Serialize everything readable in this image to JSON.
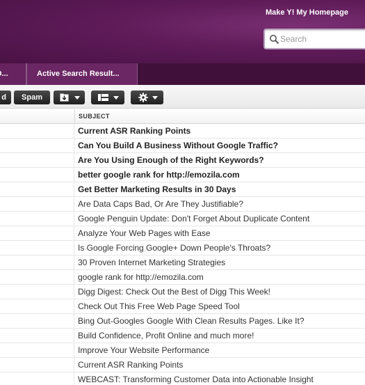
{
  "header": {
    "homepage_link": "Make Y! My Homepage",
    "search_placeholder": "Search"
  },
  "tabs": [
    {
      "label": "O..."
    },
    {
      "label": "Active Search Result..."
    }
  ],
  "toolbar": {
    "left_label": "d",
    "spam_label": "Spam"
  },
  "columns": {
    "subject": "SUBJECT"
  },
  "messages": [
    {
      "subject": "Current ASR Ranking Points",
      "unread": true
    },
    {
      "subject": "Can You Build A Business Without Google Traffic?",
      "unread": true
    },
    {
      "subject": "Are You Using Enough of the Right Keywords?",
      "unread": true
    },
    {
      "subject": "better google rank for http://emozila.com",
      "unread": true
    },
    {
      "subject": "Get Better Marketing Results in 30 Days",
      "unread": true
    },
    {
      "subject": "Are Data Caps Bad, Or Are They Justifiable?",
      "unread": false
    },
    {
      "subject": "Google Penguin Update: Don't Forget About Duplicate Content",
      "unread": false
    },
    {
      "subject": "Analyze Your Web Pages with Ease",
      "unread": false
    },
    {
      "subject": "Is Google Forcing Google+ Down People's Throats?",
      "unread": false
    },
    {
      "subject": "30 Proven Internet Marketing Strategies",
      "unread": false
    },
    {
      "subject": "google rank for http://emozila.com",
      "unread": false
    },
    {
      "subject": "Digg Digest: Check Out the Best of Digg This Week!",
      "unread": false
    },
    {
      "subject": "Check Out This Free Web Page Speed Tool",
      "unread": false
    },
    {
      "subject": "Bing Out-Googles Google With Clean Results Pages. Like It?",
      "unread": false
    },
    {
      "subject": "Build Confidence, Profit Online and much more!",
      "unread": false
    },
    {
      "subject": "Improve Your Website Performance",
      "unread": false
    },
    {
      "subject": "Current ASR Ranking Points",
      "unread": false
    },
    {
      "subject": "WEBCAST: Transforming Customer Data into Actionable Insight",
      "unread": false
    }
  ],
  "icons": {
    "search": "search-icon",
    "move": "move-to-folder-icon",
    "view": "view-layout-icon",
    "settings": "gear-icon",
    "dropdown": "chevron-down-icon"
  }
}
